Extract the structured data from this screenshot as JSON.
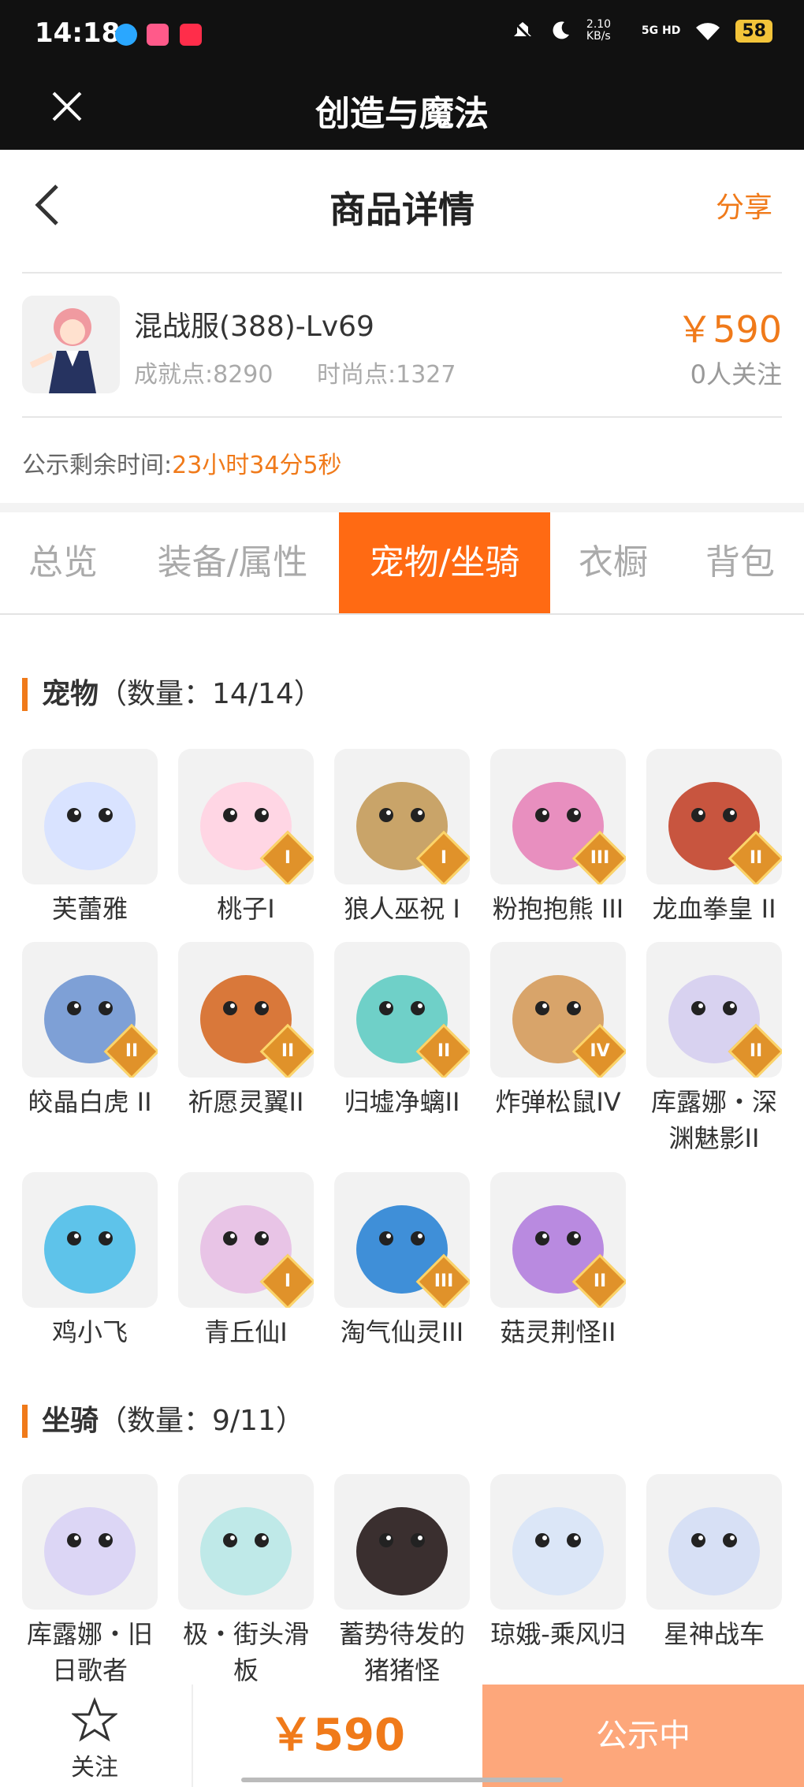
{
  "status_bar": {
    "time": "14:18",
    "net_speed": "2.10 KB/s",
    "network": "5G HD",
    "battery": "58"
  },
  "app_bar": {
    "title": "创造与魔法"
  },
  "nav": {
    "title": "商品详情",
    "share": "分享"
  },
  "product": {
    "name": "混战服(388)-Lv69",
    "achievement": "成就点:8290",
    "fashion": "时尚点:1327",
    "price": "￥590",
    "follows": "0人关注"
  },
  "countdown": {
    "label": "公示剩余时间:",
    "value": "23小时34分5秒"
  },
  "tabs": [
    "总览",
    "装备/属性",
    "宠物/坐骑",
    "衣橱",
    "背包"
  ],
  "pets": {
    "title": "宠物",
    "count": "（数量：14/14）",
    "items": [
      {
        "name": "芙蕾雅",
        "rank": "",
        "color": "#d9e3ff"
      },
      {
        "name": "桃子I",
        "rank": "I",
        "color": "#ffd6e4"
      },
      {
        "name": "狼人巫祝 I",
        "rank": "I",
        "color": "#c9a469"
      },
      {
        "name": "粉抱抱熊 III",
        "rank": "III",
        "color": "#e88fbf"
      },
      {
        "name": "龙血拳皇 II",
        "rank": "II",
        "color": "#c8553f"
      },
      {
        "name": "皎晶白虎 II",
        "rank": "II",
        "color": "#7ea0d6"
      },
      {
        "name": "祈愿灵翼II",
        "rank": "II",
        "color": "#d9783a"
      },
      {
        "name": "归墟净螭II",
        "rank": "II",
        "color": "#6fd0c8"
      },
      {
        "name": "炸弹松鼠IV",
        "rank": "IV",
        "color": "#d8a46a"
      },
      {
        "name": "库露娜・深渊魅影II",
        "rank": "II",
        "color": "#d8d2f0"
      },
      {
        "name": "鸡小飞",
        "rank": "",
        "color": "#5ec3ea"
      },
      {
        "name": "青丘仙I",
        "rank": "I",
        "color": "#e8c4e6"
      },
      {
        "name": "淘气仙灵III",
        "rank": "III",
        "color": "#3f8fd8"
      },
      {
        "name": "菇灵荆怪II",
        "rank": "II",
        "color": "#b98ae0"
      }
    ]
  },
  "mounts": {
    "title": "坐骑",
    "count": "（数量：9/11）",
    "items": [
      {
        "name": "库露娜・旧日歌者",
        "rank": "",
        "color": "#dcd6f5"
      },
      {
        "name": "极・街头滑板",
        "rank": "",
        "color": "#bfe9e8"
      },
      {
        "name": "蓄势待发的猪猪怪",
        "rank": "",
        "color": "#3a2f2f"
      },
      {
        "name": "琼娥-乘风归",
        "rank": "",
        "color": "#dbe6f7"
      },
      {
        "name": "星神战车",
        "rank": "",
        "color": "#d7e0f5"
      }
    ]
  },
  "bottom": {
    "follow": "关注",
    "price": "￥590",
    "button": "公示中"
  }
}
